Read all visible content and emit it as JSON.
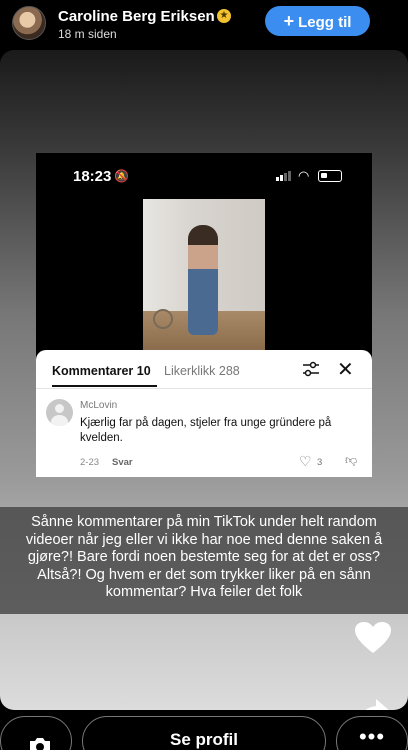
{
  "header": {
    "name": "Caroline Berg Eriksen",
    "time": "18 m siden",
    "follow_label": "Legg til"
  },
  "screenshot": {
    "status_time": "18:23",
    "tabs": [
      {
        "label": "Kommentarer 10",
        "active": true
      },
      {
        "label": "Likerklikk 288",
        "active": false
      }
    ],
    "comment": {
      "user": "McLovin",
      "text": "Kjærlig far på dagen, stjeler fra unge gründere på kvelden.",
      "time": "2-23",
      "reply_label": "Svar",
      "likes": "3"
    }
  },
  "caption": "Sånne kommentarer på min TikTok under helt random videoer når jeg eller vi ikke har noe med denne saken å gjøre?! Bare fordi noen bestemte seg for at det er oss? Altså?! Og hvem er det som trykker liker på en sånn kommentar? Hva feiler det folk",
  "bottom": {
    "profile_label": "Se profil",
    "more_label": "•••"
  },
  "colors": {
    "accent": "#3b8ef0",
    "badge": "#f2c230"
  },
  "icons": [
    "verified-badge-icon",
    "plus-icon",
    "bell-mute-icon",
    "signal-icon",
    "wifi-icon",
    "battery-icon",
    "filter-icon",
    "close-icon",
    "heart-outline-icon",
    "dislike-icon",
    "heart-icon",
    "share-icon",
    "camera-icon",
    "more-icon"
  ]
}
